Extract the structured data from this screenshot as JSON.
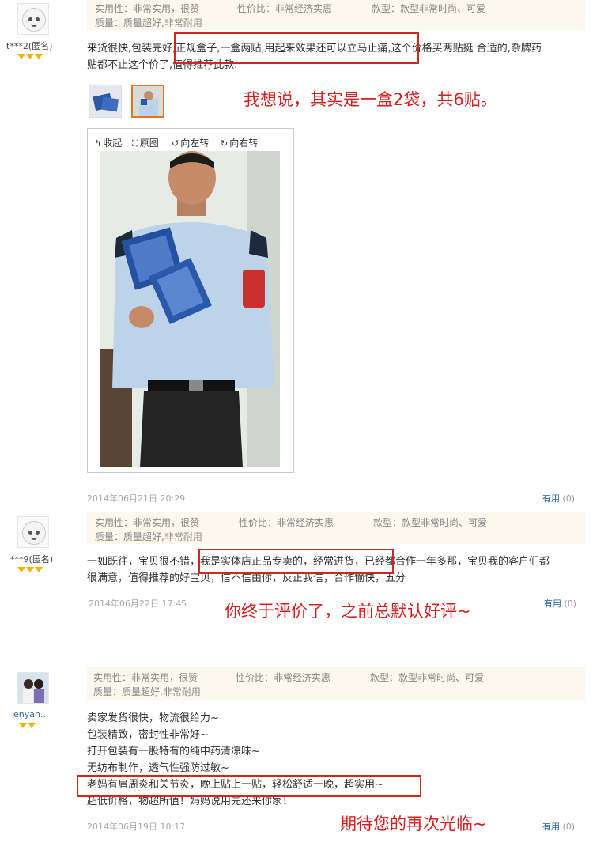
{
  "colors": {
    "annotation_red": "#d81e1e",
    "link_blue": "#2266aa",
    "gem_gold": "#f0b400",
    "tag_bg": "#fdf8ee"
  },
  "reviews": [
    {
      "user": "t***2(匿名)",
      "avatar_icon": "default-face-avatar",
      "tags": {
        "practical": "实用性：非常实用，很赞",
        "value": "性价比：非常经济实惠",
        "style": "款型：款型非常时尚、可爱",
        "quality": "质量：质量超好,非常耐用"
      },
      "content_lines": [
        "来货很快,包装完好,正规盒子,一盒两贴,用起来效果还可以立马止痛,这个价格买两贴挺 合适的,杂牌药",
        "贴都不止这个价了,值得推荐此款."
      ],
      "date": "2014年06月21日 20:29",
      "useful_label": "有用",
      "useful_count": "(0)",
      "annotation": "我想说，其实是一盒2袋，共6贴。",
      "viewer_tools": {
        "collapse": "收起",
        "original": "原图",
        "rotate_left": "向左转",
        "rotate_right": "向右转"
      }
    },
    {
      "user": "l***9(匿名)",
      "avatar_icon": "default-face-avatar",
      "tags": {
        "practical": "实用性：非常实用，很赞",
        "value": "性价比：非常经济实惠",
        "style": "款型：款型非常时尚、可爱",
        "quality": "质量：质量超好,非常耐用"
      },
      "content_lines": [
        "一如既往，宝贝很不错，我是实体店正品专卖的，经常进货，已经都合作一年多那，宝贝我的客户们都",
        "很满意，值得推荐的好宝贝，信不信由你，反正我信，合作愉快，五分"
      ],
      "date": "2014年06月22日 17:45",
      "useful_label": "有用",
      "useful_count": "(0)",
      "annotation": "你终于评价了，之前总默认好评~"
    },
    {
      "user": "enyan...",
      "avatar_icon": "photo-avatar",
      "tags": {
        "practical": "实用性：非常实用，很赞",
        "value": "性价比：非常经济实惠",
        "style": "款型：款型非常时尚、可爱",
        "quality": "质量：质量超好,非常耐用"
      },
      "content_lines": [
        "卖家发货很快，物流很给力~",
        "包装精致，密封性非常好~",
        "打开包装有一股特有的纯中药清凉味~",
        "无纺布制作，透气性强防过敏~",
        "老妈有肩周炎和关节炎，晚上贴上一贴，轻松舒适一晚，超实用~",
        "超低价格，物超所值！妈妈说用完还来你家！"
      ],
      "date": "2014年06月19日 10:17",
      "useful_label": "有用",
      "useful_count": "(0)",
      "annotation": "期待您的再次光临~"
    }
  ]
}
